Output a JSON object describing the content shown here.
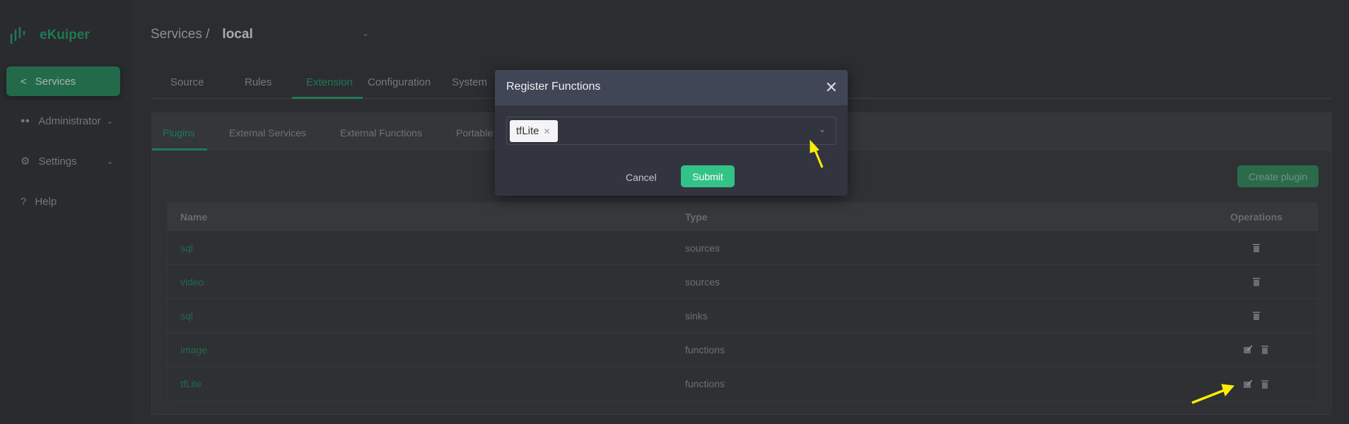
{
  "app": {
    "name": "eKuiper"
  },
  "sidebar": {
    "items": [
      {
        "label": "Services",
        "icon": "share-icon",
        "active": true
      },
      {
        "label": "Administrator",
        "icon": "users-icon"
      },
      {
        "label": "Settings",
        "icon": "gear-icon"
      },
      {
        "label": "Help",
        "icon": "help-icon"
      }
    ]
  },
  "breadcrumb": {
    "root": "Services /",
    "current": "local"
  },
  "tabs": [
    "Source",
    "Rules",
    "Extension",
    "Configuration",
    "System"
  ],
  "active_tab": "Extension",
  "subtabs": [
    "Plugins",
    "External Services",
    "External Functions",
    "Portable"
  ],
  "active_subtab": "Plugins",
  "create_label": "Create plugin",
  "table": {
    "headers": [
      "Name",
      "Type",
      "Operations"
    ],
    "rows": [
      {
        "name": "sql",
        "type": "sources",
        "edit": false
      },
      {
        "name": "video",
        "type": "sources",
        "edit": false
      },
      {
        "name": "sql",
        "type": "sinks",
        "edit": false
      },
      {
        "name": "image",
        "type": "functions",
        "edit": true
      },
      {
        "name": "tfLite",
        "type": "functions",
        "edit": true
      }
    ]
  },
  "modal": {
    "title": "Register Functions",
    "selected": [
      "tfLite"
    ],
    "cancel": "Cancel",
    "submit": "Submit"
  },
  "colors": {
    "accent": "#34c387",
    "annotation": "#ffee00"
  }
}
